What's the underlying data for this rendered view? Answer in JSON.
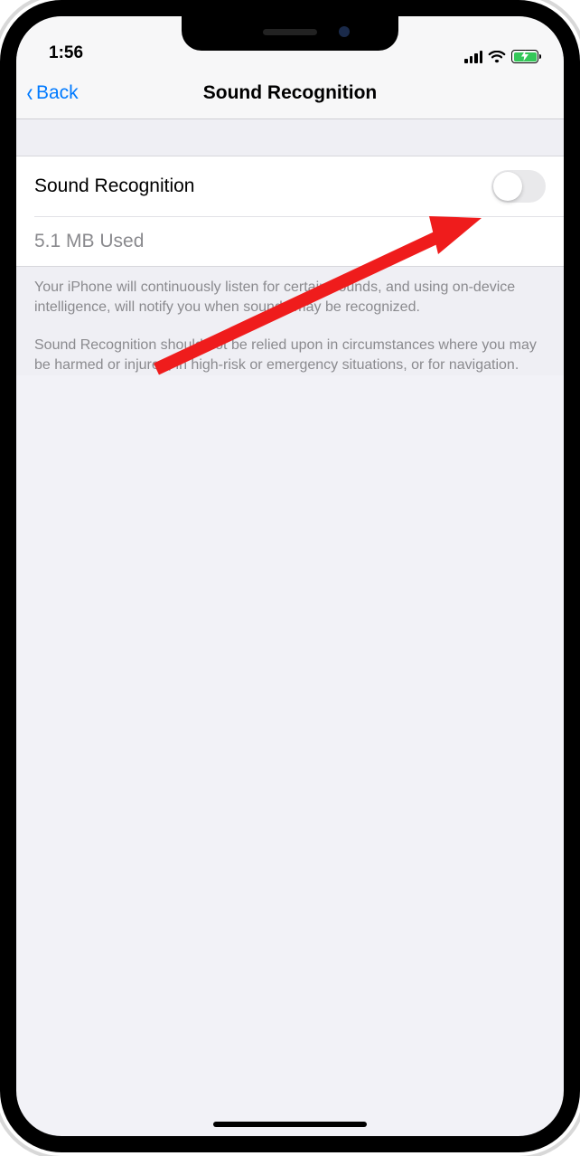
{
  "status": {
    "time": "1:56"
  },
  "nav": {
    "back_label": "Back",
    "title": "Sound Recognition"
  },
  "settings": {
    "toggle_label": "Sound Recognition",
    "toggle_on": false,
    "storage_label": "5.1 MB Used"
  },
  "footer": {
    "p1": "Your iPhone will continuously listen for certain sounds, and using on-device intelligence, will notify you when sounds may be recognized.",
    "p2": "Sound Recognition should not be relied upon in circumstances where you may be harmed or injured, in high-risk or emergency situations, or for navigation."
  }
}
